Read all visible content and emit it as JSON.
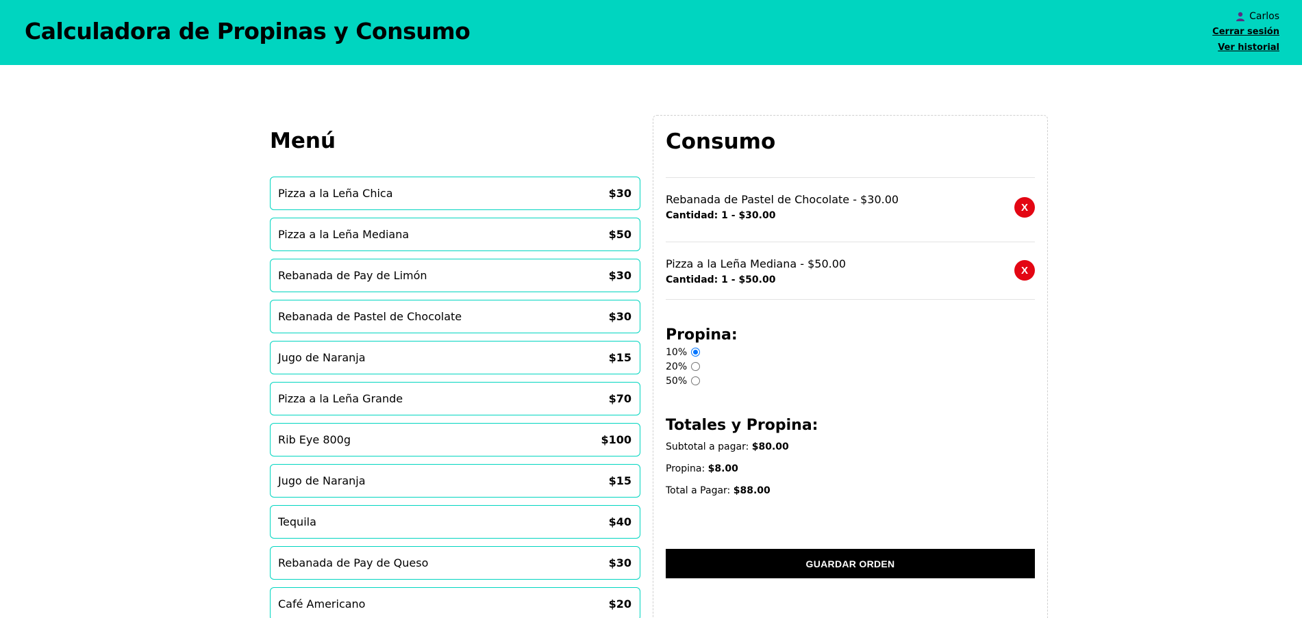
{
  "header": {
    "title": "Calculadora de Propinas y Consumo",
    "user_icon": "user-icon",
    "user_name": "Carlos",
    "logout_label": "Cerrar sesión",
    "history_label": "Ver historial",
    "background_color": "#00d5c0"
  },
  "menu": {
    "title": "Menú",
    "items": [
      {
        "name": "Pizza a la Leña Chica",
        "price": "$30"
      },
      {
        "name": "Pizza a la Leña Mediana",
        "price": "$50"
      },
      {
        "name": "Rebanada de Pay de Limón",
        "price": "$30"
      },
      {
        "name": "Rebanada de Pastel de Chocolate",
        "price": "$30"
      },
      {
        "name": "Jugo de Naranja",
        "price": "$15"
      },
      {
        "name": "Pizza a la Leña Grande",
        "price": "$70"
      },
      {
        "name": "Rib Eye 800g",
        "price": "$100"
      },
      {
        "name": "Jugo de Naranja",
        "price": "$15"
      },
      {
        "name": "Tequila",
        "price": "$40"
      },
      {
        "name": "Rebanada de Pay de Queso",
        "price": "$30"
      },
      {
        "name": "Café Americano",
        "price": "$20"
      }
    ]
  },
  "consumo": {
    "title": "Consumo",
    "orders": [
      {
        "name": "Rebanada de Pastel de Chocolate - $30.00",
        "quantity": "Cantidad: 1 - $30.00",
        "remove_label": "X"
      },
      {
        "name": "Pizza a la Leña Mediana - $50.00",
        "quantity": "Cantidad: 1 - $50.00",
        "remove_label": "X"
      }
    ],
    "tip": {
      "title": "Propina:",
      "options": [
        "10%",
        "20%",
        "50%"
      ],
      "selected": "10%"
    },
    "totals": {
      "title": "Totales y Propina:",
      "subtotal_label": "Subtotal a pagar:",
      "subtotal_value": "$80.00",
      "tip_label": "Propina:",
      "tip_value": "$8.00",
      "total_label": "Total a Pagar:",
      "total_value": "$88.00"
    },
    "save_label": "GUARDAR ORDEN"
  }
}
